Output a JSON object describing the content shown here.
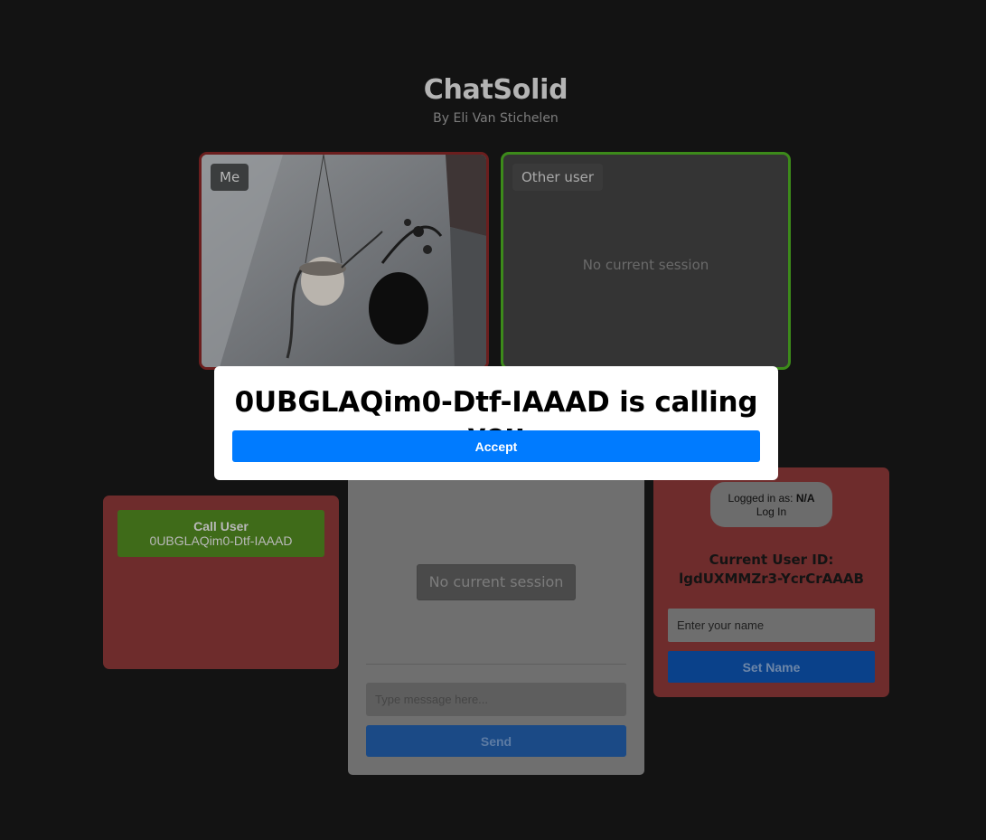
{
  "header": {
    "title": "ChatSolid",
    "subtitle": "By Eli Van Stichelen"
  },
  "videos": {
    "me_label": "Me",
    "other_label": "Other user",
    "other_status": "No current session"
  },
  "call_panel": {
    "button_title": "Call User",
    "button_user_id": "0UBGLAQim0-Dtf-IAAAD"
  },
  "chat": {
    "status": "No current session",
    "message_placeholder": "Type message here...",
    "send_label": "Send"
  },
  "user_panel": {
    "logged_in_prefix": "Logged in as: ",
    "logged_in_value": "N/A",
    "login_link": "Log In",
    "current_id_label": "Current User ID:",
    "current_id_value": "lgdUXMMZr3-YcrCrAAAB",
    "name_placeholder": "Enter your name",
    "set_name_label": "Set Name"
  },
  "modal": {
    "title": "0UBGLAQim0-Dtf-IAAAD is calling you",
    "accept_label": "Accept"
  },
  "colors": {
    "background": "#131313",
    "me_border": "#6b1e1e",
    "other_border": "#3c8a1a",
    "panel_red": "#6e2c2c",
    "call_green": "#3f6b19",
    "accept_blue": "#007bff"
  }
}
